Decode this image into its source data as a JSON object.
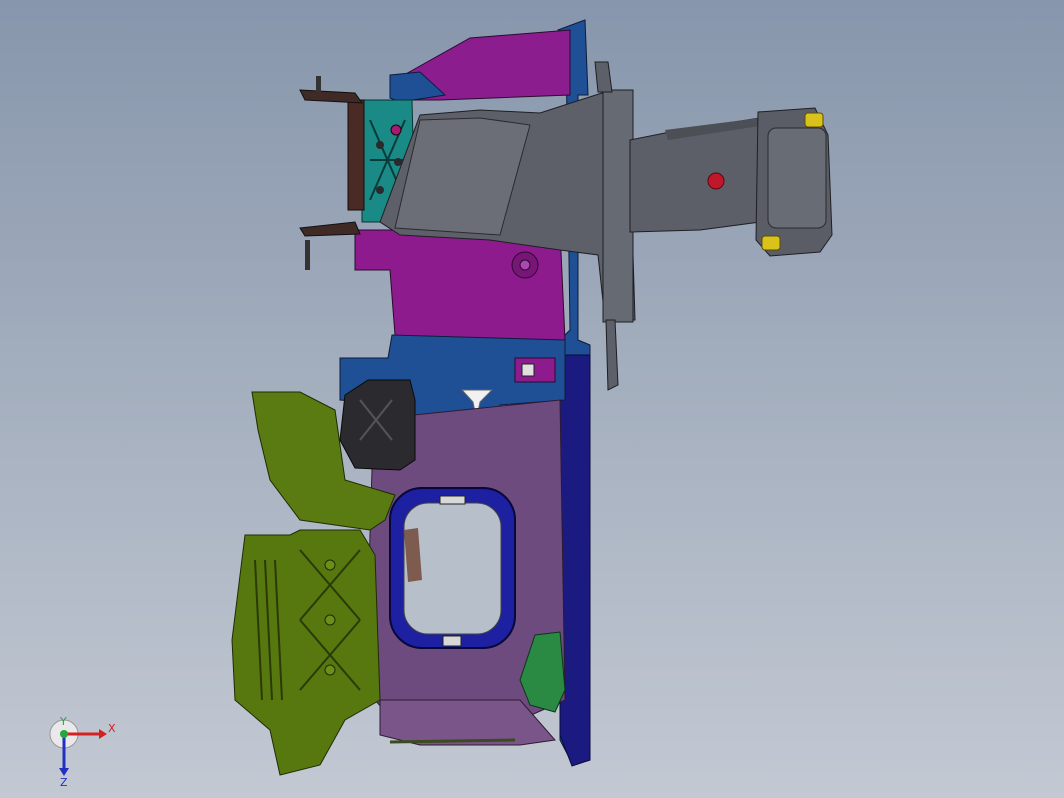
{
  "viewport": {
    "background_top": "#8796ac",
    "background_bottom": "#c3c9d3"
  },
  "model": {
    "colors": {
      "magenta": "#8e1b8e",
      "blue": "#1d4f92",
      "navy": "#1a1a7c",
      "purple": "#6d4a7d",
      "gray": "#5c5f67",
      "olive": "#5a7a10",
      "teal": "#1a8a86",
      "black": "#26262a",
      "green": "#2a8a44",
      "yellow": "#d9c21a",
      "red": "#c0182a",
      "brown": "#4a2a24"
    }
  },
  "triad": {
    "x_label": "X",
    "y_label": "Y",
    "z_label": "Z",
    "x_color": "#d42020",
    "y_color": "#22a83a",
    "z_color": "#2030c0"
  }
}
